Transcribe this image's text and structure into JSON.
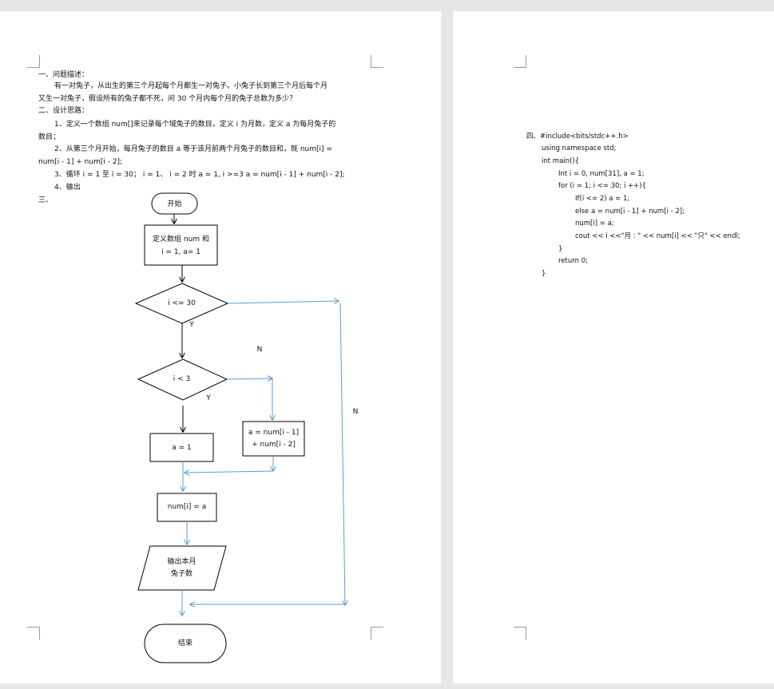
{
  "doc": {
    "page1": {
      "lines": {
        "h1": "一、问题描述：",
        "p1a": "有一对兔子，从出生的第三个月起每个月都生一对兔子。小兔子长到第三个月后每个月",
        "p1b": "又生一对兔子，假设所有的兔子都不死，问 30 个月内每个月的兔子总数为多少？",
        "h2": "二、设计思路：",
        "s1a": "1、定义一个数组 num[]来记录每个域兔子的数目，定义 i 为月数，定义 a 为每月兔子的",
        "s1b": "数目；",
        "s2a": "2、从第三个月开始，每月兔子的数目 a 等于该月前两个月兔子的数目和，既 num[i] =",
        "s2b": "num[i - 1] + num[i - 2];",
        "s3": "3、循环 i = 1 至 i = 30；    i = 1、    i = 2 时  a = 1, i >=3 a = num[i - 1] + num[i - 2];",
        "s4": "4、输出",
        "h3": "三、"
      },
      "flowchart": {
        "start": "开始",
        "define_line1": "定义数组 num 和",
        "define_line2": "i = 1, a= 1",
        "cond1": "i <= 30",
        "cond2": "i < 3",
        "assign_a1": "a = 1",
        "assign_sum_line1": "a = num[i - 1]",
        "assign_sum_line2": "+ num[i - 2]",
        "store": "num[i] = a",
        "output_line1": "输出本月",
        "output_line2": "兔子数",
        "end": "结束",
        "label_y1": "Y",
        "label_y2": "Y",
        "label_n1": "N",
        "label_n2": "N"
      }
    },
    "page2": {
      "code": [
        "四、#include<bits/stdc++.h>",
        "using namespace std;",
        "int main(){",
        "Int i = 0, num[31], a = 1;",
        "for (i = 1; i <= 30; i ++){",
        "If(i <= 2) a = 1;",
        "else a = num[i - 1] + num[i - 2];",
        "num[i] = a;",
        "cout << i <<\"月  : \" << num[i] << \"只\" << endl;",
        "}",
        "return 0;",
        "}"
      ]
    }
  },
  "colors": {
    "arrow_blue": "#5b9bd5",
    "arrow_black": "#000000",
    "page_bg": "#ffffff",
    "canvas_bg": "#e6e6e6"
  }
}
